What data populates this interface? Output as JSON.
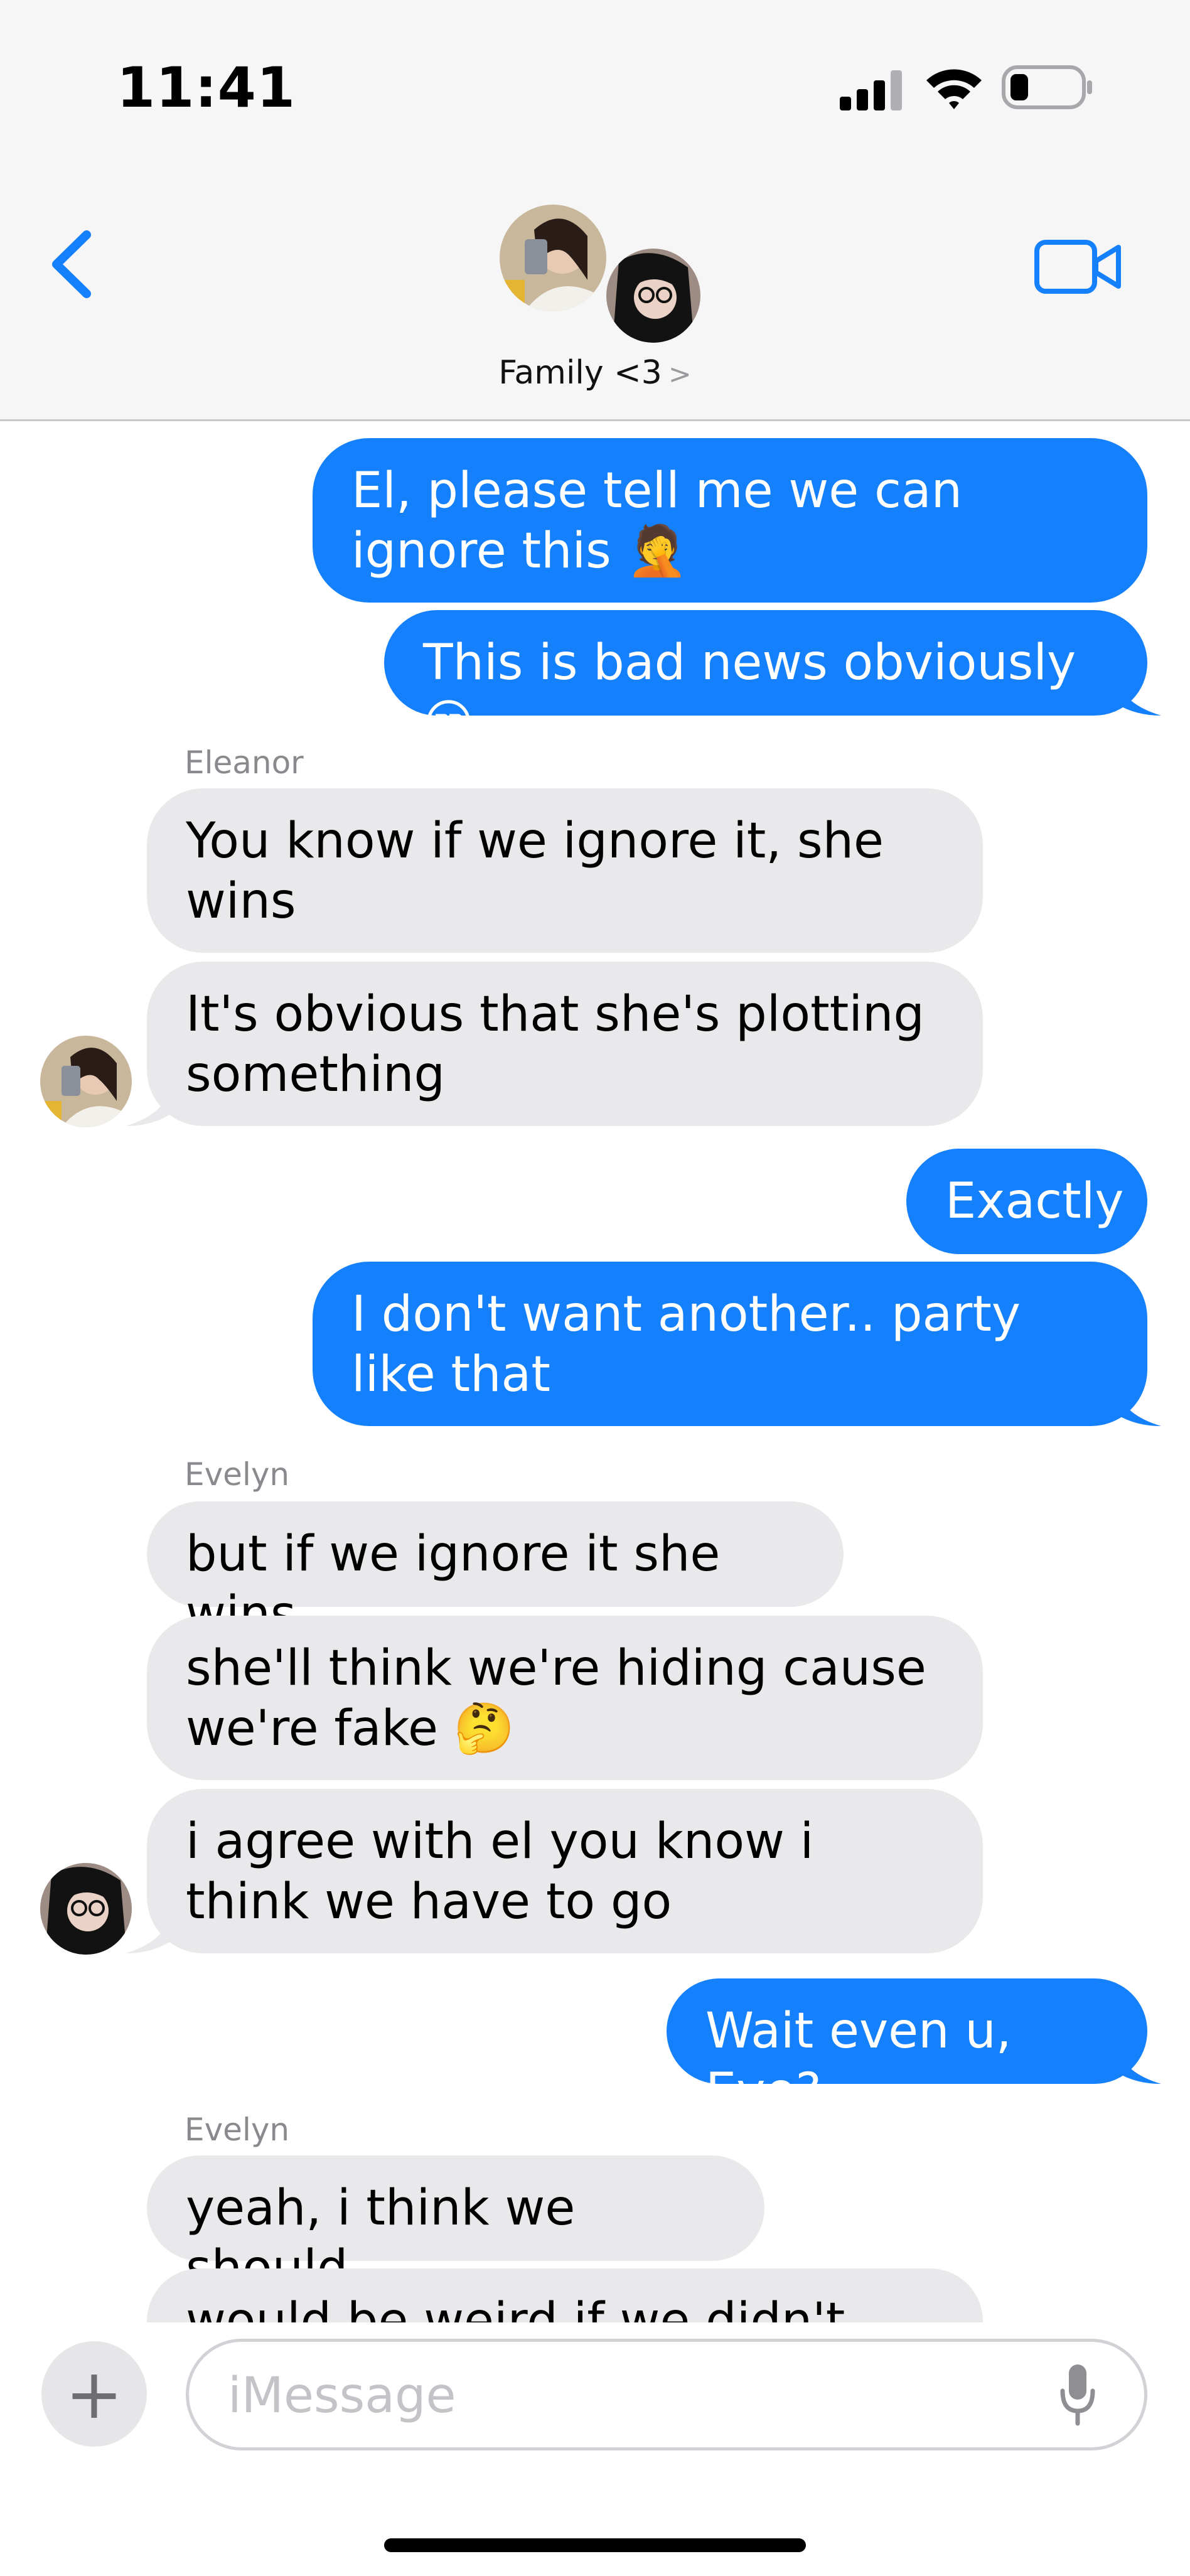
{
  "status_bar": {
    "time": "11:41"
  },
  "header": {
    "group_name": "Family <3",
    "chevron": ">"
  },
  "colors": {
    "outgoing_bubble": "#1580fb",
    "incoming_bubble": "#e9e9eb",
    "accent": "#1580fb"
  },
  "messages": [
    {
      "direction": "out",
      "text": "El, please tell me we can ignore this 🤦"
    },
    {
      "direction": "out",
      "text": "This is bad news obviously 😒"
    },
    {
      "direction": "in",
      "sender": "Eleanor",
      "text": "You know if we ignore it, she wins"
    },
    {
      "direction": "in",
      "text": "It's obvious that she's plotting something"
    },
    {
      "direction": "out",
      "text": "Exactly"
    },
    {
      "direction": "out",
      "text": "I don't want another.. party like that"
    },
    {
      "direction": "in",
      "sender": "Evelyn",
      "text": "but if we ignore it she wins"
    },
    {
      "direction": "in",
      "text": "she'll think we're hiding cause we're fake 🤔"
    },
    {
      "direction": "in",
      "text": "i agree with el you know i think we have to go"
    },
    {
      "direction": "out",
      "text": "Wait even u, Eve?"
    },
    {
      "direction": "in",
      "sender": "Evelyn",
      "text": "yeah, i think we should"
    },
    {
      "direction": "in",
      "text": "would be weird if we didn't"
    }
  ],
  "compose": {
    "placeholder": "iMessage",
    "plus": "+"
  },
  "icons": [
    "back-chevron-icon",
    "video-camera-icon",
    "plus-icon",
    "microphone-icon",
    "cellular-signal-icon",
    "wifi-icon",
    "battery-icon"
  ]
}
